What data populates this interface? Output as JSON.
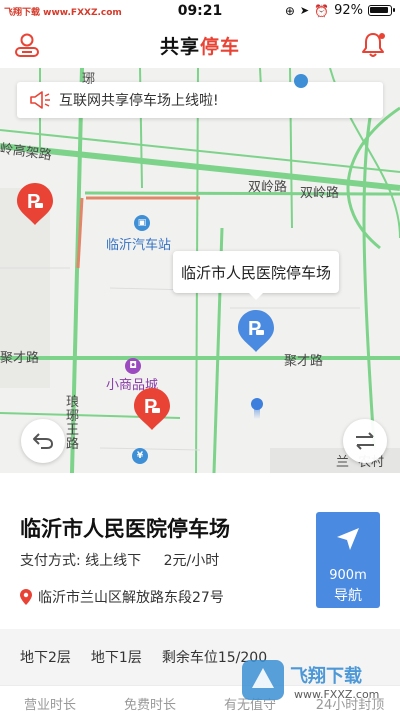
{
  "watermark": {
    "top": "飞翔下载 www.FXXZ.com",
    "bottom_cn": "飞翔下载",
    "bottom_en": "www.FXXZ.com"
  },
  "status": {
    "time": "09:21",
    "battery": "92%"
  },
  "header": {
    "title_main": "共享",
    "title_accent": "停车"
  },
  "notice": {
    "text": "互联网共享停车场上线啦!"
  },
  "map": {
    "labels": {
      "gaojia": "岭高架路",
      "shuangling1": "双岭路",
      "shuangling2": "双岭路",
      "jucai_left": "聚才路",
      "jucai_right": "聚才路",
      "station": "临沂汽车站",
      "mall": "小商品城",
      "langya": "琅\n琊\n王\n路",
      "lan": "兰",
      "nong": "农村",
      "top_char": "琊"
    },
    "callout": "临沂市人民医院停车场",
    "pins": [
      {
        "color": "#e94335",
        "label": "P"
      },
      {
        "color": "#4a8ae0",
        "label": "P"
      },
      {
        "color": "#e94335",
        "label": "P"
      }
    ]
  },
  "lot": {
    "name": "临沂市人民医院停车场",
    "payment_label": "支付方式:",
    "payment_value": "线上线下",
    "price": "2元/小时",
    "address": "临沂市兰山区解放路东段27号",
    "distance": "900m",
    "navigate": "导航"
  },
  "floors": {
    "b2": "地下2层",
    "b1": "地下1层",
    "remaining": "剩余车位15/200"
  },
  "info_strip": [
    "营业时长",
    "免费时长",
    "有无值守",
    "24小时封顶"
  ],
  "colors": {
    "brand_red": "#e94335",
    "nav_blue": "#4a8ae0",
    "road_green": "#7dd38a"
  }
}
